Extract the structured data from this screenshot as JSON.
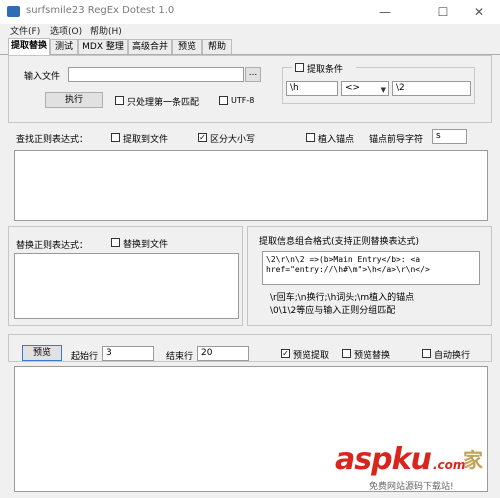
{
  "window": {
    "title": "surfsmile23 RegEx Dotest 1.0",
    "minimize": "—",
    "maximize": "☐",
    "close": "✕"
  },
  "menu": [
    "文件(F)",
    "选项(O)",
    "帮助(H)"
  ],
  "tabs": [
    "提取替换",
    "测试",
    "MDX 整理",
    "高级合并",
    "预览",
    "帮助"
  ],
  "top": {
    "input_file_label": "输入文件",
    "input_file_value": "",
    "browse_label": "...",
    "run_label": "执行",
    "first_match_only_label": "只处理第一条匹配",
    "utf8_label": "UTF-8",
    "condition_label": "提取条件",
    "condition_field1": "\\h",
    "condition_select": "<>",
    "condition_field2": "\\2"
  },
  "find": {
    "label": "查找正则表达式：",
    "extract_to_file_label": "提取到文件",
    "case_sensitive_label": "区分大小写",
    "case_sensitive_checked": true,
    "insert_anchor_label": "植入锚点",
    "anchor_prefix_label": "锚点前导字符",
    "anchor_prefix_value": "s"
  },
  "replace": {
    "label": "替换正则表达式：",
    "replace_to_file_label": "替换到文件"
  },
  "format": {
    "title": "提取信息组合格式(支持正则替换表达式)",
    "code_line1": "\\2\\r\\n\\2 =>(b>Main Entry</b>: <a",
    "code_line2": "href=\"entry://\\h#\\m\">\\h</a>\\r\\n</>",
    "help_line1": "\\r回车;\\n换行;\\h词头;\\m植入的锚点",
    "help_line2": "\\0\\1\\2等应与输入正则分组匹配"
  },
  "preview": {
    "button_label": "预览",
    "start_line_label": "起始行",
    "start_line_value": "3",
    "end_line_label": "结束行",
    "end_line_value": "20",
    "preview_extract_label": "预览提取",
    "preview_extract_checked": true,
    "preview_replace_label": "预览替换",
    "auto_wrap_label": "自动换行"
  },
  "watermark": {
    "brand": "aspku",
    "brand_suffix": ".com",
    "glyph": "家",
    "slogan": "免费网站源码下载站!"
  },
  "colors": {
    "accent": "#3a78d6",
    "watermark_red": "#d9261c"
  }
}
